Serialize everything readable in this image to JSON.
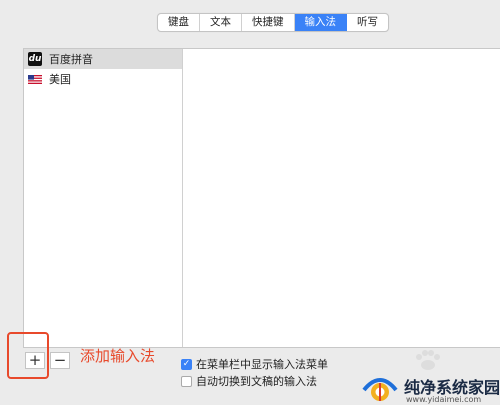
{
  "tabs": [
    {
      "label": "键盘",
      "active": false
    },
    {
      "label": "文本",
      "active": false
    },
    {
      "label": "快捷键",
      "active": false
    },
    {
      "label": "输入法",
      "active": true
    },
    {
      "label": "听写",
      "active": false
    }
  ],
  "input_sources": [
    {
      "label": "百度拼音",
      "icon_text": "du",
      "icon": "baidu-du-icon",
      "selected": true
    },
    {
      "label": "美国",
      "icon": "us-flag-icon",
      "selected": false
    }
  ],
  "buttons": {
    "add": "+",
    "remove": "−"
  },
  "annotation": "添加输入法",
  "options": [
    {
      "label": "在菜单栏中显示输入法菜单",
      "checked": true
    },
    {
      "label": "自动切换到文稿的输入法",
      "checked": false
    }
  ],
  "watermark": {
    "text": "纯净系统家园",
    "url": "www.yidaimei.com"
  },
  "colors": {
    "accent": "#3a82f7",
    "annotation": "#e8492b"
  }
}
